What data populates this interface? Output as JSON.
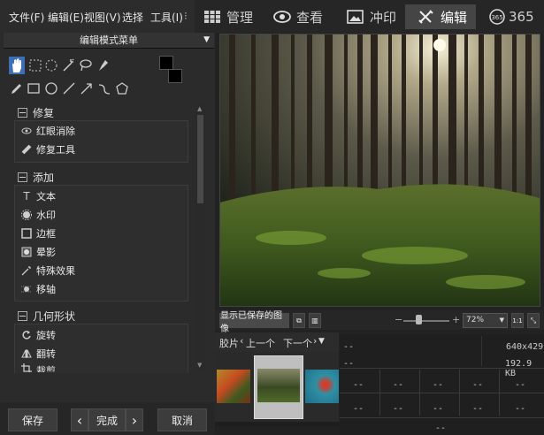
{
  "menu": [
    "文件(F)",
    "编辑(E)",
    "视图(V)",
    "选择",
    "工具(I)"
  ],
  "modes": [
    {
      "label": "管理",
      "icon": "grid-icon"
    },
    {
      "label": "查看",
      "icon": "eye-icon"
    },
    {
      "label": "冲印",
      "icon": "photo-icon"
    },
    {
      "label": "编辑",
      "icon": "tools-icon"
    },
    {
      "label": "365",
      "icon": "365-icon"
    }
  ],
  "panel": {
    "title": "编辑模式菜单"
  },
  "sections": [
    {
      "title": "修复",
      "items": [
        "红眼消除",
        "修复工具"
      ]
    },
    {
      "title": "添加",
      "items": [
        "文本",
        "水印",
        "边框",
        "晕影",
        "特殊效果",
        "移轴"
      ]
    },
    {
      "title": "几何形状",
      "items": [
        "旋转",
        "翻转",
        "裁剪"
      ]
    }
  ],
  "buttons": {
    "save": "保存",
    "prev": "‹",
    "finish": "完成",
    "next": "›",
    "cancel": "取消"
  },
  "image_toolbar": {
    "show_saved": "显示已保存的图像",
    "zoom": "72%",
    "one_to_one": "1:1"
  },
  "filmstrip": {
    "label": "胶片",
    "prev": "上一个",
    "next": "下一个"
  },
  "info": {
    "row1_left": "--",
    "dimensions": "640x429",
    "row2_left": "--",
    "size": "192.9 KB",
    "dash": "--"
  },
  "colors": {
    "accent": "#3d6fb6",
    "background": "#1c1c1c",
    "active_tab": "#454545"
  }
}
